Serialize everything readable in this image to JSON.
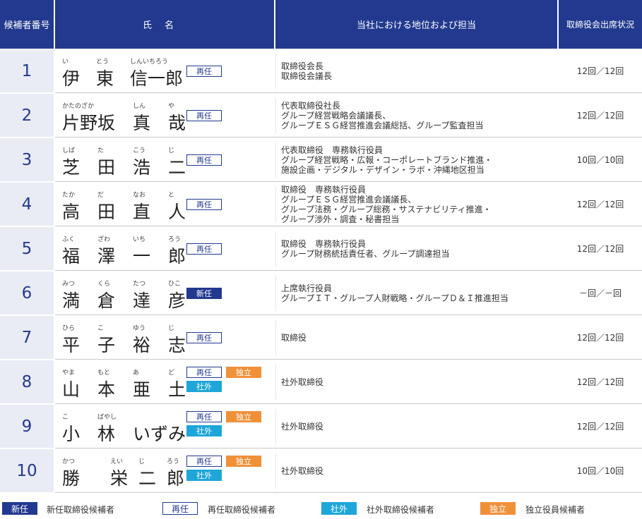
{
  "header": {
    "number": "候補者番号",
    "name": "氏名",
    "position": "当社における地位および担当",
    "attendance": "取締役会出席状況"
  },
  "badge_labels": {
    "reappoint": "再任",
    "new": "新任",
    "independent": "独立",
    "outside": "社外"
  },
  "candidates": [
    {
      "no": "1",
      "chars": [
        "伊",
        "東",
        "信一郎"
      ],
      "ruby": [
        "い",
        "とう",
        "しんいちろう"
      ],
      "badges": [
        "reappoint"
      ],
      "position": [
        "取締役会長",
        "取締役会議長"
      ],
      "attendance": "12回／12回"
    },
    {
      "no": "2",
      "chars": [
        "片野坂",
        "真",
        "哉"
      ],
      "ruby": [
        "かたのざか",
        "しん",
        "や"
      ],
      "badges": [
        "reappoint"
      ],
      "position": [
        "代表取締役社長",
        "グループ経営戦略会議議長、",
        "グループＥＳＧ経営推進会議総括、グループ監査担当"
      ],
      "attendance": "12回／12回"
    },
    {
      "no": "3",
      "chars": [
        "芝",
        "田",
        "浩",
        "二"
      ],
      "ruby": [
        "しば",
        "た",
        "こう",
        "じ"
      ],
      "badges": [
        "reappoint"
      ],
      "position": [
        "代表取締役　専務執行役員",
        "グループ経営戦略・広報・コーポレートブランド推進・",
        "施設企画・デジタル・デザイン・ラボ・沖縄地区担当"
      ],
      "attendance": "10回／10回"
    },
    {
      "no": "4",
      "chars": [
        "高",
        "田",
        "直",
        "人"
      ],
      "ruby": [
        "たか",
        "だ",
        "なお",
        "と"
      ],
      "badges": [
        "reappoint"
      ],
      "position": [
        "取締役　専務執行役員",
        "グループＥＳＧ経営推進会議議長、",
        "グループ法務・グループ総務・サステナビリティ推進・",
        "グループ渉外・調査・秘書担当"
      ],
      "attendance": "12回／12回"
    },
    {
      "no": "5",
      "chars": [
        "福",
        "澤",
        "一",
        "郎"
      ],
      "ruby": [
        "ふく",
        "ざわ",
        "いち",
        "ろう"
      ],
      "badges": [
        "reappoint"
      ],
      "position": [
        "取締役　専務執行役員",
        "グループ財務統括責任者、グループ調達担当"
      ],
      "attendance": "12回／12回"
    },
    {
      "no": "6",
      "chars": [
        "満",
        "倉",
        "達",
        "彦"
      ],
      "ruby": [
        "みつ",
        "くら",
        "たつ",
        "ひこ"
      ],
      "badges": [
        "new"
      ],
      "position": [
        "上席執行役員",
        "グループＩＴ・グループ人財戦略・グループＤ＆Ｉ推進担当"
      ],
      "attendance": "－回／－回"
    },
    {
      "no": "7",
      "chars": [
        "平",
        "子",
        "裕",
        "志"
      ],
      "ruby": [
        "ひら",
        "こ",
        "ゆう",
        "じ"
      ],
      "badges": [
        "reappoint"
      ],
      "position": [
        "取締役"
      ],
      "attendance": "12回／12回"
    },
    {
      "no": "8",
      "chars": [
        "山",
        "本",
        "亜",
        "土"
      ],
      "ruby": [
        "やま",
        "もと",
        "あ",
        "ど"
      ],
      "badges": [
        "reappoint",
        "independent",
        "outside"
      ],
      "position": [
        "社外取締役"
      ],
      "attendance": "12回／12回"
    },
    {
      "no": "9",
      "chars": [
        "小",
        "林",
        "いずみ"
      ],
      "ruby": [
        "こ",
        "ばやし",
        ""
      ],
      "badges": [
        "reappoint",
        "independent",
        "outside"
      ],
      "position": [
        "社外取締役"
      ],
      "attendance": "12回／12回"
    },
    {
      "no": "10",
      "chars": [
        "勝",
        "栄",
        "二",
        "郎"
      ],
      "ruby": [
        "かつ",
        "えい",
        "じ",
        "ろう"
      ],
      "badges": [
        "reappoint",
        "independent",
        "outside"
      ],
      "position": [
        "社外取締役"
      ],
      "attendance": "10回／10回"
    }
  ],
  "legend": {
    "new_label": "新任",
    "new_text": "新任取締役候補者",
    "reappoint_label": "再任",
    "reappoint_text": "再任取締役候補者",
    "outside_label": "社外",
    "outside_text": "社外取締役候補者",
    "independent_label": "独立",
    "independent_text": "独立役員候補者"
  },
  "colors": {
    "navy": "#22398f",
    "orange": "#f0913a",
    "cyan": "#1fa6d8",
    "number_bg": "#e9ecf4"
  }
}
